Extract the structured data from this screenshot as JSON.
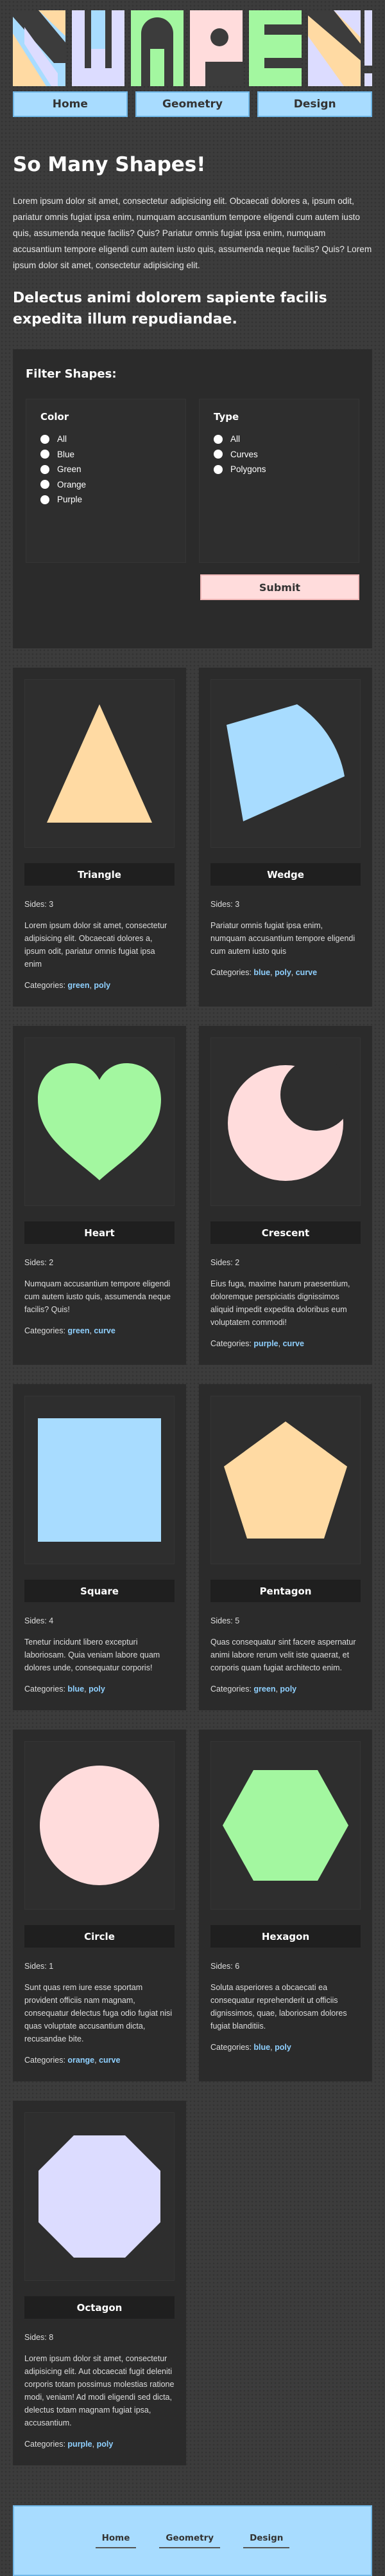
{
  "logo": {
    "text": "SHAPES!"
  },
  "nav": {
    "home": "Home",
    "geometry": "Geometry",
    "design": "Design"
  },
  "intro": {
    "title": "So Many Shapes!",
    "paragraph": "Lorem ipsum dolor sit amet, consectetur adipisicing elit. Obcaecati dolores a, ipsum odit, pariatur omnis fugiat ipsa enim, numquam accusantium tempore eligendi cum autem iusto quis, assumenda neque facilis? Quis? Pariatur omnis fugiat ipsa enim, numquam accusantium tempore eligendi cum autem iusto quis, assumenda neque facilis? Quis? Lorem ipsum dolor sit amet, consectetur adipisicing elit.",
    "subtitle": "Delectus animi dolorem sapiente facilis expedita illum repudiandae."
  },
  "filter": {
    "title": "Filter Shapes:",
    "color": {
      "title": "Color",
      "options": [
        "All",
        "Blue",
        "Green",
        "Orange",
        "Purple"
      ]
    },
    "type": {
      "title": "Type",
      "options": [
        "All",
        "Curves",
        "Polygons"
      ]
    },
    "submit": "Submit"
  },
  "colors": {
    "blue": "#a8dcff",
    "green": "#a3f7a0",
    "orange": "#ffdaa3",
    "pink": "#ffdcdc",
    "purple": "#dcdcff"
  },
  "shapes": [
    {
      "name": "Triangle",
      "sides": "Sides: 3",
      "desc": "Lorem ipsum dolor sit amet, consectetur adipisicing elit. Obcaecati dolores a, ipsum odit, pariatur omnis fugiat ipsa enim",
      "cats_label": "Categories:",
      "cats": [
        "green",
        "poly"
      ],
      "fill": "#ffdaa3"
    },
    {
      "name": "Wedge",
      "sides": "Sides: 3",
      "desc": "Pariatur omnis fugiat ipsa enim, numquam accusantium tempore eligendi cum autem iusto quis",
      "cats_label": "Categories:",
      "cats": [
        "blue",
        "poly",
        "curve"
      ],
      "fill": "#a8dcff"
    },
    {
      "name": "Heart",
      "sides": "Sides: 2",
      "desc": "Numquam accusantium tempore eligendi cum autem iusto quis, assumenda neque facilis? Quis!",
      "cats_label": "Categories:",
      "cats": [
        "green",
        "curve"
      ],
      "fill": "#a3f7a0"
    },
    {
      "name": "Crescent",
      "sides": "Sides: 2",
      "desc": "Eius fuga, maxime harum praesentium, doloremque perspiciatis dignissimos aliquid impedit expedita doloribus eum voluptatem commodi!",
      "cats_label": "Categories:",
      "cats": [
        "purple",
        "curve"
      ],
      "fill": "#ffdcdc"
    },
    {
      "name": "Square",
      "sides": "Sides: 4",
      "desc": "Tenetur incidunt libero excepturi laboriosam. Quia veniam labore quam dolores unde, consequatur corporis!",
      "cats_label": "Categories:",
      "cats": [
        "blue",
        "poly"
      ],
      "fill": "#a8dcff"
    },
    {
      "name": "Pentagon",
      "sides": "Sides: 5",
      "desc": "Quas consequatur sint facere aspernatur animi labore rerum velit iste quaerat, et corporis quam fugiat architecto enim.",
      "cats_label": "Categories:",
      "cats": [
        "green",
        "poly"
      ],
      "fill": "#ffdaa3"
    },
    {
      "name": "Circle",
      "sides": "Sides: 1",
      "desc": "Sunt quas rem iure esse sportam provident officiis nam magnam, consequatur delectus fuga odio fugiat nisi quas voluptate accusantium dicta, recusandae bite.",
      "cats_label": "Categories:",
      "cats": [
        "orange",
        "curve"
      ],
      "fill": "#ffdcdc"
    },
    {
      "name": "Hexagon",
      "sides": "Sides: 6",
      "desc": "Soluta asperiores a obcaecati ea consequatur reprehenderit ut officiis dignissimos, quae, laboriosam dolores fugiat blanditiis.",
      "cats_label": "Categories:",
      "cats": [
        "blue",
        "poly"
      ],
      "fill": "#a3f7a0"
    },
    {
      "name": "Octagon",
      "sides": "Sides: 8",
      "desc": "Lorem ipsum dolor sit amet, consectetur adipisicing elit. Aut obcaecati fugit deleniti corporis totam possimus molestias ratione modi, veniam! Ad modi eligendi sed dicta, delectus totam magnam fugiat ipsa, accusantium.",
      "cats_label": "Categories:",
      "cats": [
        "purple",
        "poly"
      ],
      "fill": "#dcdcff"
    }
  ],
  "footer": {
    "home": "Home",
    "geometry": "Geometry",
    "design": "Design"
  }
}
